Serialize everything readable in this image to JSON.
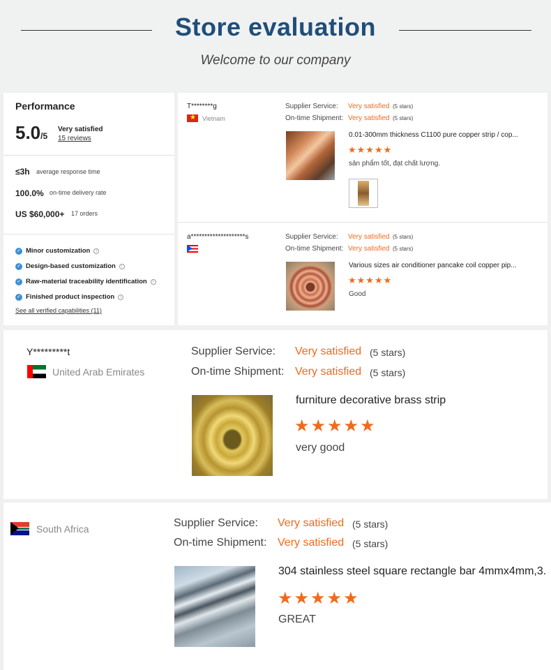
{
  "header": {
    "title": "Store evaluation",
    "subtitle": "Welcome to our company"
  },
  "performance": {
    "title": "Performance",
    "score": "5.0",
    "score_max": "/5",
    "rating_text": "Very satisfied",
    "reviews_link": "15 reviews",
    "metrics": [
      {
        "value": "≤3h",
        "label": "average response time"
      },
      {
        "value": "100.0%",
        "label": "on-time delivery rate"
      },
      {
        "value": "US $60,000+",
        "label": "17 orders"
      }
    ],
    "capabilities": [
      "Minor customization",
      "Design-based customization",
      "Raw-material traceability identification",
      "Finished product inspection"
    ],
    "all_capabilities_link": "See all verified capabilities (11)"
  },
  "labels": {
    "supplier_service": "Supplier Service:",
    "ontime_shipment": "On-time Shipment:",
    "very_satisfied": "Very satisfied",
    "five_stars": "(5 stars)",
    "stars_glyph": "★★★★★"
  },
  "reviews": [
    {
      "reviewer": "T********g",
      "country": "Vietnam",
      "flag": "vietnam-flag-icon",
      "product": "0.01-300mm thickness C1100 pure copper strip / cop...",
      "comment": "sản phẩm tốt, đạt chất lượng."
    },
    {
      "reviewer": "a********************s",
      "country": "",
      "flag": "puerto-rico-flag-icon",
      "product": "Various sizes air conditioner pancake coil copper pip...",
      "comment": "Good"
    },
    {
      "reviewer": "Y*********t",
      "country": "United Arab Emirates",
      "flag": "uae-flag-icon",
      "product": "furniture decorative brass strip",
      "comment": "very good"
    },
    {
      "reviewer": "",
      "country": "South Africa",
      "flag": "south-africa-flag-icon",
      "product": "304 stainless steel square rectangle bar 4mmx4mm,3.",
      "comment": "GREAT"
    }
  ],
  "colors": {
    "title_blue": "#1f4e79",
    "orange": "#f06a1d",
    "check_blue": "#3d8fd6"
  }
}
